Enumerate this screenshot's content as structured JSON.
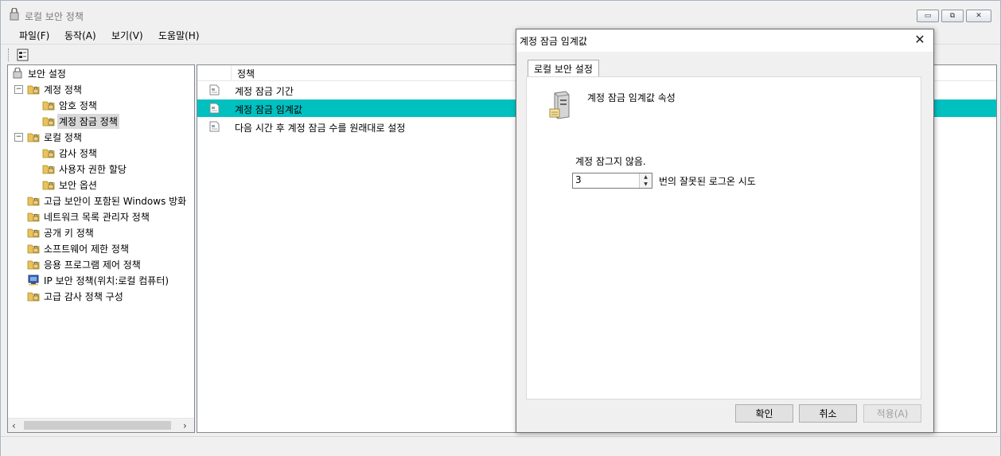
{
  "window": {
    "title": "로컬 보안 정책",
    "minimize_label": "▭",
    "restore_label": "⧉",
    "close_label": "✕"
  },
  "menu": [
    {
      "label": "파일(F)"
    },
    {
      "label": "동작(A)"
    },
    {
      "label": "보기(V)"
    },
    {
      "label": "도움말(H)"
    }
  ],
  "tree": {
    "root": "보안 설정",
    "items": [
      {
        "label": "계정 정책",
        "level": 1,
        "expander": "−"
      },
      {
        "label": "암호 정책",
        "level": 2
      },
      {
        "label": "계정 잠금 정책",
        "level": 2,
        "selected": true
      },
      {
        "label": "로컬 정책",
        "level": 1,
        "expander": "−"
      },
      {
        "label": "감사 정책",
        "level": 2
      },
      {
        "label": "사용자 권한 할당",
        "level": 2
      },
      {
        "label": "보안 옵션",
        "level": 2
      },
      {
        "label": "고급 보안이 포함된 Windows 방화",
        "level": 1
      },
      {
        "label": "네트워크 목록 관리자 정책",
        "level": 1
      },
      {
        "label": "공개 키 정책",
        "level": 1
      },
      {
        "label": "소프트웨어 제한 정책",
        "level": 1
      },
      {
        "label": "응용 프로그램 제어 정책",
        "level": 1
      },
      {
        "label": "IP 보안 정책(위치:로컬 컴퓨터)",
        "level": 1,
        "icon": "network-policy-icon"
      },
      {
        "label": "고급 감사 정책 구성",
        "level": 1
      }
    ]
  },
  "list": {
    "column_header": "정책",
    "rows": [
      {
        "label": "계정 잠금 기간"
      },
      {
        "label": "계정 잠금 임계값",
        "selected": true
      },
      {
        "label": "다음 시간 후 계정 잠금 수를 원래대로 설정"
      }
    ]
  },
  "dialog": {
    "title": "계정 잠금 임계값",
    "close_label": "✕",
    "tab_label": "로컬 보안 설정",
    "property_title": "계정 잠금 임계값 속성",
    "setting_label": "계정 잠그지 않음.",
    "spin_value": "3",
    "spin_suffix": "번의 잘못된 로그온 시도",
    "ok_label": "확인",
    "cancel_label": "취소",
    "apply_label": "적용(A)"
  },
  "colors": {
    "selection": "#00c0c0",
    "folder": "#e8c35a"
  }
}
